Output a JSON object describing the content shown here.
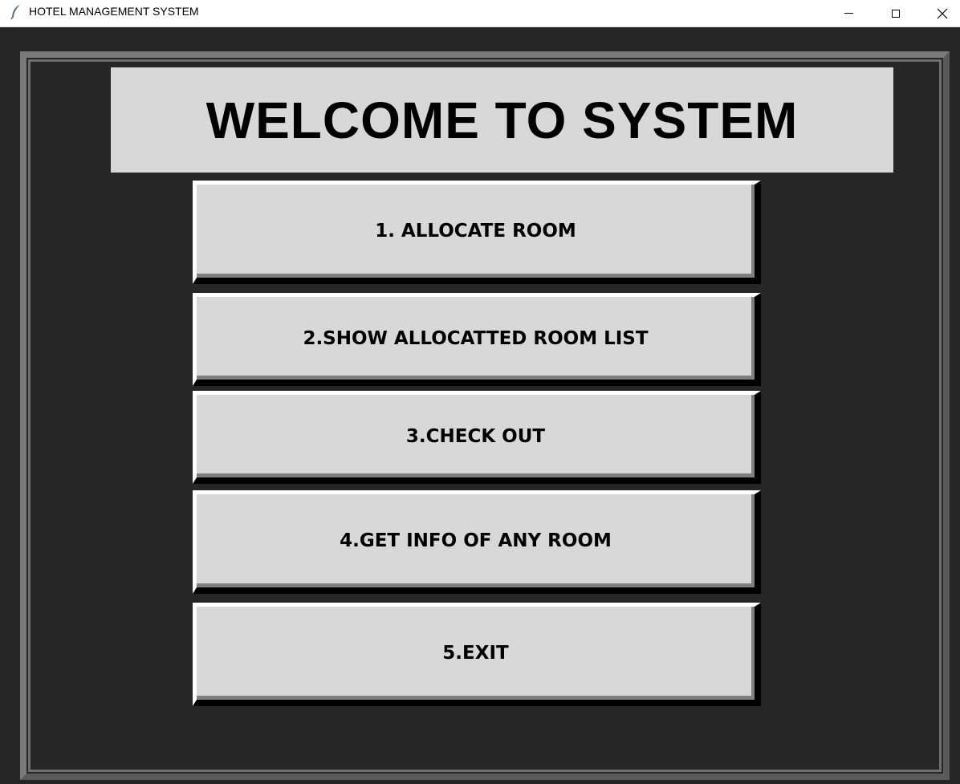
{
  "window": {
    "title": "HOTEL MANAGEMENT SYSTEM",
    "icon": "feather-icon",
    "controls": [
      "minimize-icon",
      "maximize-icon",
      "close-icon"
    ]
  },
  "header": {
    "welcome": "WELCOME TO SYSTEM"
  },
  "menu": {
    "items": [
      {
        "label": "1. ALLOCATE ROOM"
      },
      {
        "label": "2.SHOW ALLOCATTED ROOM LIST"
      },
      {
        "label": "3.CHECK OUT"
      },
      {
        "label": "4.GET INFO OF ANY ROOM"
      },
      {
        "label": "5.EXIT"
      }
    ]
  },
  "colors": {
    "background": "#262626",
    "panel": "#d8d8d8",
    "frame": "#7a7a7a",
    "text": "#000000"
  }
}
